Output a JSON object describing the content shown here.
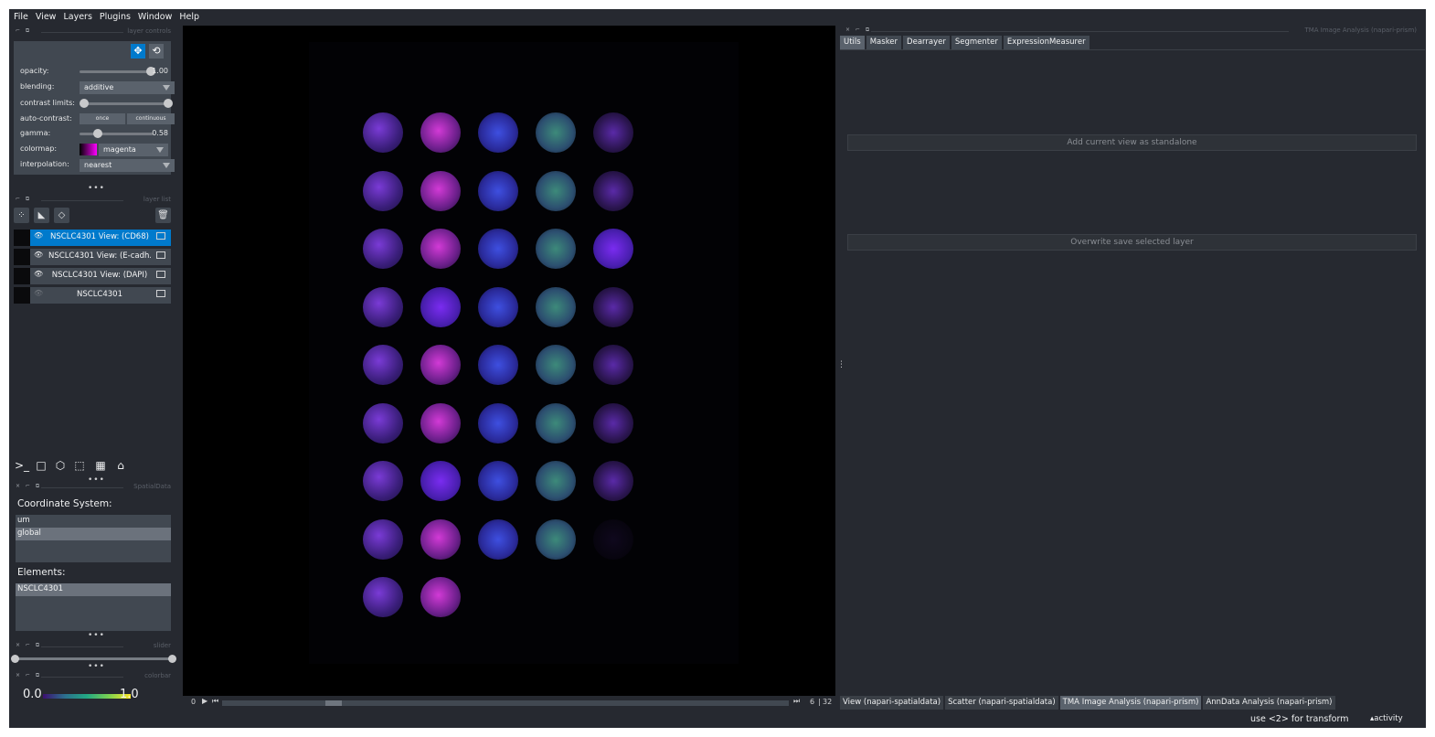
{
  "menu": [
    "File",
    "View",
    "Layers",
    "Plugins",
    "Window",
    "Help"
  ],
  "docks": {
    "layer_controls": "layer controls",
    "layer_list": "layer list",
    "spatialdata": "SpatialData",
    "slider": "slider",
    "colorbar": "colorbar",
    "tma": "TMA Image Analysis (napari-prism)"
  },
  "layer_controls": {
    "opacity_label": "opacity:",
    "opacity_value": "1.00",
    "opacity": 1.0,
    "blending_label": "blending:",
    "blending": "additive",
    "contrast_label": "contrast limits:",
    "contrast_range": [
      0.0,
      1.0
    ],
    "autocontrast_label": "auto-contrast:",
    "once": "once",
    "continuous": "continuous",
    "gamma_label": "gamma:",
    "gamma_value": "0.58",
    "gamma": 0.25,
    "colormap_label": "colormap:",
    "colormap": "magenta",
    "interpolation_label": "interpolation:",
    "interpolation": "nearest"
  },
  "layers": [
    {
      "name": "NSCLC4301 View: (CD68)",
      "visible": true,
      "selected": true
    },
    {
      "name": "NSCLC4301 View: (E-cadh...",
      "visible": true,
      "selected": false
    },
    {
      "name": "NSCLC4301 View: (DAPI)",
      "visible": true,
      "selected": false
    },
    {
      "name": "NSCLC4301",
      "visible": false,
      "selected": false
    }
  ],
  "spatialdata": {
    "coord_heading": "Coordinate System:",
    "coords": [
      {
        "label": "um",
        "selected": false
      },
      {
        "label": "global",
        "selected": true
      }
    ],
    "elements_heading": "Elements:",
    "elements": [
      {
        "label": "NSCLC4301",
        "selected": true
      }
    ]
  },
  "colorbar": {
    "min": "0.0",
    "max": "1.0"
  },
  "dims": {
    "start": "0",
    "current": "6",
    "total": "32"
  },
  "tma": {
    "tabs": [
      {
        "label": "Utils",
        "active": true
      },
      {
        "label": "Masker",
        "active": false
      },
      {
        "label": "Dearrayer",
        "active": false
      },
      {
        "label": "Segmenter",
        "active": false
      },
      {
        "label": "ExpressionMeasurer",
        "active": false
      }
    ],
    "add_view_button": "Add current view as standalone",
    "overwrite_button": "Overwrite save selected layer"
  },
  "bottom_tabs": [
    {
      "label": "View (napari-spatialdata)",
      "active": false
    },
    {
      "label": "Scatter (napari-spatialdata)",
      "active": false
    },
    {
      "label": "TMA Image Analysis (napari-prism)",
      "active": true
    },
    {
      "label": "AnnData Analysis (napari-prism)",
      "active": false
    }
  ],
  "status": {
    "hint": "use <2> for transform",
    "activity": "activity"
  },
  "colors": {
    "bg": "#262930",
    "panel": "#414851",
    "accent": "#007acc",
    "magenta": "#ff00ff"
  }
}
